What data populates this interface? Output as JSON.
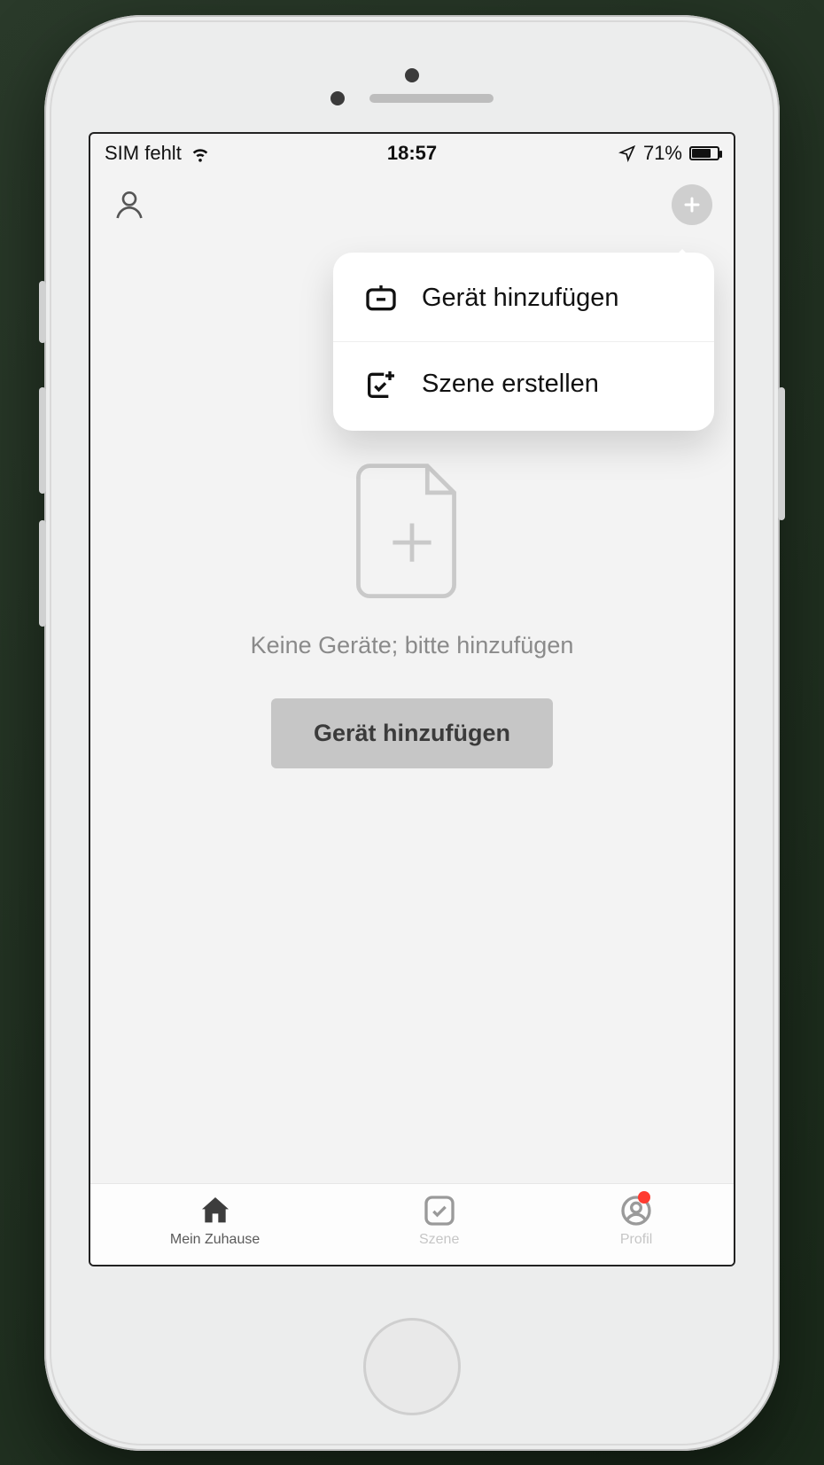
{
  "status_bar": {
    "carrier": "SIM fehlt",
    "time": "18:57",
    "battery_pct": "71%"
  },
  "popover": {
    "add_device": "Gerät hinzufügen",
    "create_scene": "Szene erstellen"
  },
  "empty_state": {
    "text": "Keine Geräte; bitte hinzufügen",
    "cta": "Gerät hinzufügen"
  },
  "tabs": {
    "home": "Mein Zuhause",
    "scene": "Szene",
    "profile": "Profil"
  }
}
